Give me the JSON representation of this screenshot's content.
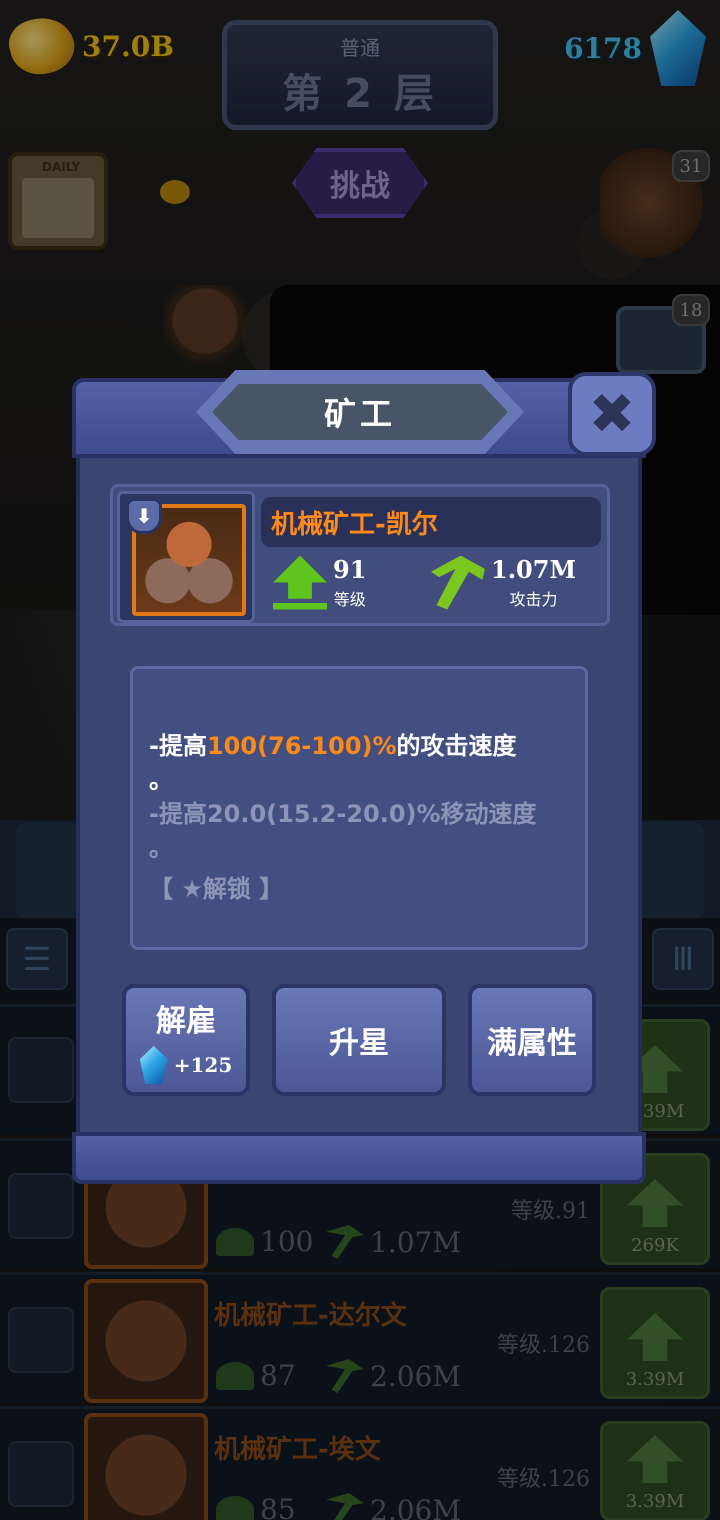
{
  "hud": {
    "gold": "37.0B",
    "gems": "6178",
    "mode": "普通",
    "floor": "第 2 层",
    "challenge_label": "挑战",
    "calendar_label": "DAILY",
    "badge_miners": "31",
    "badge_chest": "18"
  },
  "modal": {
    "title": "矿工",
    "close_label": "✖",
    "miner_name": "机械矿工-凯尔",
    "level_value": "91",
    "level_label": "等级",
    "attack_value": "1.07M",
    "attack_label": "攻击力",
    "desc": {
      "line1_prefix": "-提高",
      "line1_highlight": "100(76-100)%",
      "line1_suffix": "的攻击速度",
      "line1_tail": "。",
      "line2": "-提高20.0(15.2-20.0)%移动速度",
      "line2_tail": "。",
      "unlock": "【 ★解锁 】"
    },
    "buttons": {
      "dismiss": "解雇",
      "dismiss_reward": "+125",
      "star_up": "升星",
      "max_attr": "满属性"
    }
  },
  "list": {
    "rows": [
      {
        "name": "",
        "level": "",
        "helmet": "",
        "attack": "",
        "cost": "3.39M"
      },
      {
        "name": "",
        "level": "等级.91",
        "helmet": "100",
        "attack": "1.07M",
        "cost": "269K"
      },
      {
        "name": "机械矿工-达尔文",
        "level": "等级.126",
        "helmet": "87",
        "attack": "2.06M",
        "cost": "3.39M"
      },
      {
        "name": "机械矿工-埃文",
        "level": "等级.126",
        "helmet": "85",
        "attack": "2.06M",
        "cost": "3.39M"
      }
    ]
  }
}
